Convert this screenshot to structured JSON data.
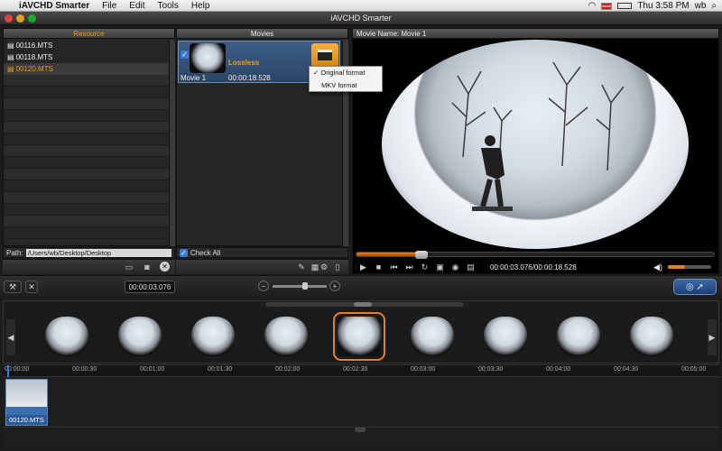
{
  "menubar": {
    "apple": "",
    "app_name": "iAVCHD Smarter",
    "items": [
      "File",
      "Edit",
      "Tools",
      "Help"
    ],
    "clock": "Thu 3:58 PM",
    "user": "wb"
  },
  "window": {
    "title": "iAVCHD Smarter"
  },
  "resource": {
    "header": "Resource",
    "files": [
      "00116.MTS",
      "00118.MTS",
      "00120.MTS"
    ],
    "selected_index": 2,
    "path_label": "Path:",
    "path_value": "/Users/wb/Desktop/Desktop"
  },
  "movies": {
    "header": "Movies",
    "item": {
      "name": "Movie 1",
      "format": "Lossless",
      "duration": "00:00:18.528",
      "checked": true
    },
    "check_all_label": "Check All",
    "menu": [
      "Original format",
      "MKV format"
    ],
    "menu_checked": 0
  },
  "preview": {
    "header_label": "Movie Name:",
    "movie_name": "Movie 1",
    "time_current": "00:00:03.076",
    "time_total": "00:00:18.528",
    "time_display": "00:00:03.076/00:00:18.528",
    "progress": 0.18,
    "volume": 0.4
  },
  "timeline": {
    "current_time": "00:00:03.076",
    "ruler": [
      "00:00:00",
      "00:00:30",
      "00:01:00",
      "00:01:30",
      "00:02:00",
      "00:02:30",
      "00:03:00",
      "00:03:30",
      "00:04:00",
      "00:04:30",
      "00:05:00"
    ],
    "clip_label": "00120.MTS",
    "thumbs_count": 9,
    "selected_thumb": 4
  }
}
